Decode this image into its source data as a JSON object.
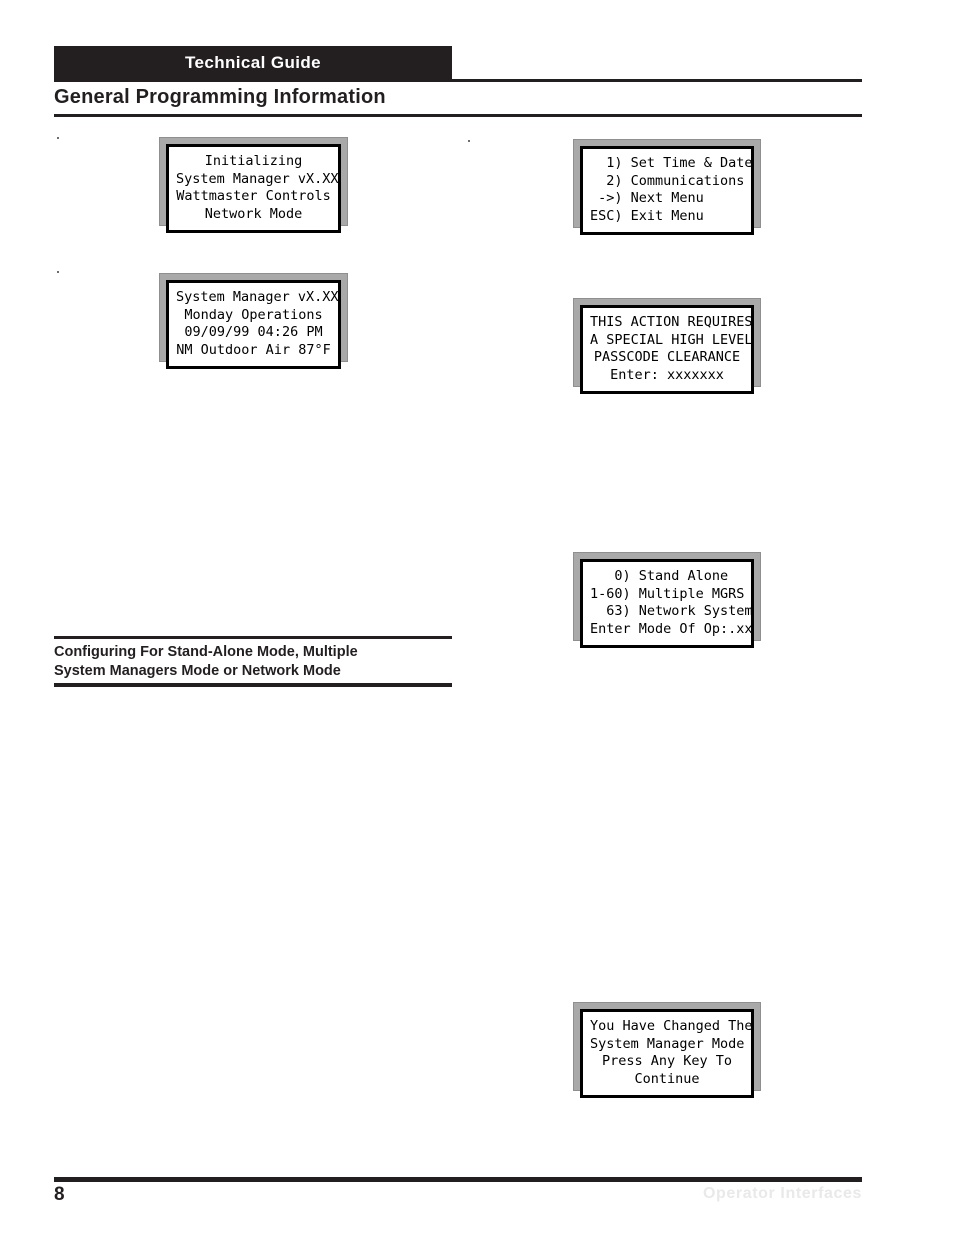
{
  "header": {
    "guide_label": "Technical Guide",
    "page_title": "General Programming Information"
  },
  "sections": {
    "configuring_heading_line1": "Configuring For Stand-Alone Mode, Multiple",
    "configuring_heading_line2": "System Managers Mode or Network Mode"
  },
  "displays": [
    {
      "id": "initializing",
      "align": "center",
      "lines": [
        "Initializing",
        "System Manager vX.XX",
        "Wattmaster Controls",
        "Network Mode"
      ]
    },
    {
      "id": "status",
      "align": "center",
      "lines": [
        "System Manager vX.XX",
        "Monday Operations",
        "09/09/99 04:26 PM",
        "NM Outdoor Air 87°F"
      ]
    },
    {
      "id": "main-menu",
      "align": "left",
      "lines": [
        "  1) Set Time & Date",
        "  2) Communications",
        " ->) Next Menu",
        "ESC) Exit Menu"
      ]
    },
    {
      "id": "passcode",
      "align": "center",
      "lines": [
        "THIS ACTION REQUIRES",
        "A SPECIAL HIGH LEVEL",
        "PASSCODE CLEARANCE",
        "Enter: xxxxxxx"
      ]
    },
    {
      "id": "mode-select",
      "align": "left",
      "lines": [
        "   0) Stand Alone",
        "1-60) Multiple MGRS",
        "  63) Network System",
        "Enter Mode Of Op:.xx"
      ]
    },
    {
      "id": "mode-changed",
      "align": "center",
      "lines": [
        "You Have Changed The",
        "System Manager Mode",
        "Press Any Key To",
        "Continue"
      ]
    }
  ],
  "footer": {
    "page_number": "8",
    "section_name": "Operator Interfaces"
  },
  "colors": {
    "ink": "#231f20",
    "lcd_bezel": "#a9a9a9",
    "footer_section_text": "#e9e9e9"
  }
}
